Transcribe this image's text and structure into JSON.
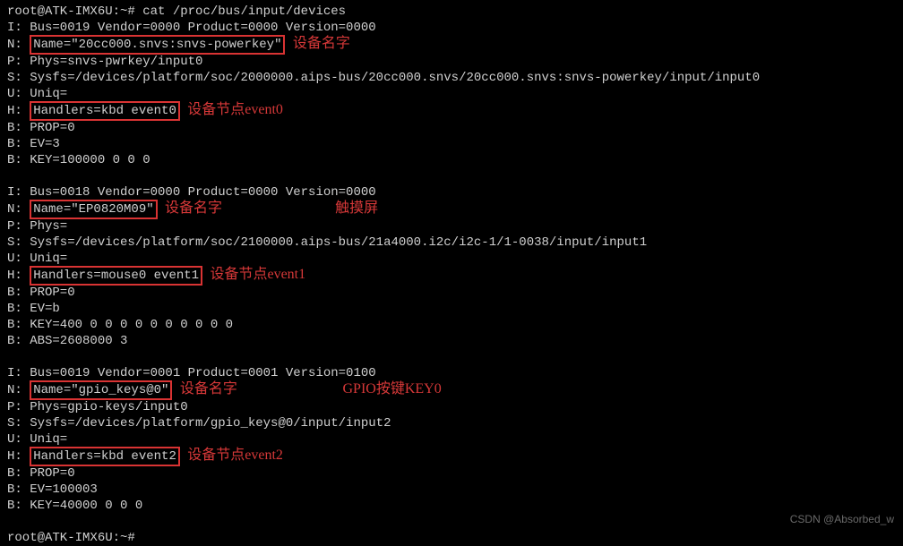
{
  "prompt": "root@ATK-IMX6U:~# ",
  "command": "cat /proc/bus/input/devices",
  "devices": [
    {
      "bus": "I: Bus=0019 Vendor=0000 Product=0000 Version=0000",
      "name_prefix": "N: ",
      "name_value": "Name=\"20cc000.snvs:snvs-powerkey\"",
      "name_annotation": "设备名字",
      "phys": "P: Phys=snvs-pwrkey/input0",
      "sysfs": "S: Sysfs=/devices/platform/soc/2000000.aips-bus/20cc000.snvs/20cc000.snvs:snvs-powerkey/input/input0",
      "uniq": "U: Uniq=",
      "handlers_prefix": "H: ",
      "handlers_value": "Handlers=kbd event0",
      "handlers_annotation": "设备节点event0",
      "prop": "B: PROP=0",
      "ev": "B: EV=3",
      "key": "B: KEY=100000 0 0 0",
      "abs": null,
      "title_annotation": null
    },
    {
      "bus": "I: Bus=0018 Vendor=0000 Product=0000 Version=0000",
      "name_prefix": "N: ",
      "name_value": "Name=\"EP0820M09\"",
      "name_annotation": "设备名字",
      "phys": "P: Phys=",
      "sysfs": "S: Sysfs=/devices/platform/soc/2100000.aips-bus/21a4000.i2c/i2c-1/1-0038/input/input1",
      "uniq": "U: Uniq=",
      "handlers_prefix": "H: ",
      "handlers_value": "Handlers=mouse0 event1",
      "handlers_annotation": "设备节点event1",
      "prop": "B: PROP=0",
      "ev": "B: EV=b",
      "key": "B: KEY=400 0 0 0 0 0 0 0 0 0 0",
      "abs": "B: ABS=2608000 3",
      "title_annotation": "触摸屏"
    },
    {
      "bus": "I: Bus=0019 Vendor=0001 Product=0001 Version=0100",
      "name_prefix": "N: ",
      "name_value": "Name=\"gpio_keys@0\"",
      "name_annotation": "设备名字",
      "phys": "P: Phys=gpio-keys/input0",
      "sysfs": "S: Sysfs=/devices/platform/gpio_keys@0/input/input2",
      "uniq": "U: Uniq=",
      "handlers_prefix": "H: ",
      "handlers_value": "Handlers=kbd event2",
      "handlers_annotation": "设备节点event2",
      "prop": "B: PROP=0",
      "ev": "B: EV=100003",
      "key": "B: KEY=40000 0 0 0",
      "abs": null,
      "title_annotation": "GPIO按键KEY0"
    }
  ],
  "final_prompt": "root@ATK-IMX6U:~#",
  "watermark": "CSDN @Absorbed_w"
}
